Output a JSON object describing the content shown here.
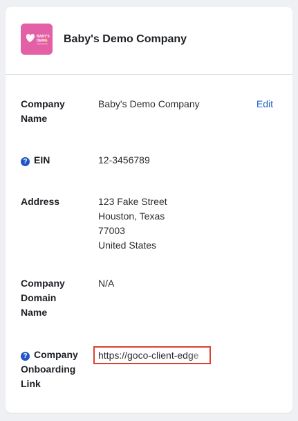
{
  "header": {
    "company_name": "Baby's Demo Company",
    "logo_text_line1": "BABY'S",
    "logo_text_line2": "DEMO"
  },
  "fields": {
    "company_name": {
      "label_line1": "Company",
      "label_line2": "Name",
      "value": "Baby's Demo Company",
      "edit_label": "Edit"
    },
    "ein": {
      "label": "EIN",
      "value": "12-3456789"
    },
    "address": {
      "label": "Address",
      "lines": [
        "123 Fake Street",
        "Houston, Texas",
        "77003",
        "United States"
      ]
    },
    "domain": {
      "label_line1": "Company",
      "label_line2": "Domain",
      "label_line3": "Name",
      "value": "N/A"
    },
    "onboarding_link": {
      "label_line1": "Company",
      "label_line2": "Onboarding",
      "label_line3": "Link",
      "value": "https://goco-client-edge"
    }
  },
  "colors": {
    "accent": "#2461c9",
    "help_icon": "#2256c7",
    "highlight_border": "#d9432d",
    "logo_background": "#e35fa6"
  },
  "icons": {
    "help": "question-circle-icon",
    "logo_heart": "heart-icon"
  }
}
